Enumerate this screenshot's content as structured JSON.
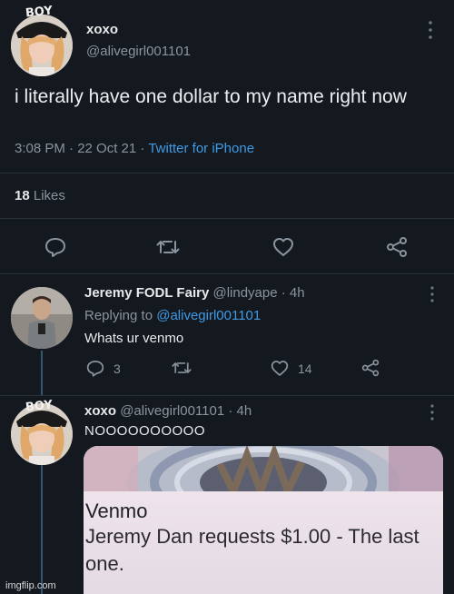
{
  "tweet": {
    "display_name": "xoxo",
    "handle": "@alivegirl001101",
    "text": "i literally have one dollar to my name right now",
    "time": "3:08 PM · 22 Oct 21 ·",
    "source": "Twitter for iPhone",
    "likes_count": "18",
    "likes_label": "Likes",
    "avatar_cap_text": "BOY"
  },
  "reply1": {
    "display_name": "Jeremy FODL Fairy",
    "handle": "@lindyape",
    "age": "· 4h",
    "replying_prefix": "Replying to",
    "replying_handle": "@alivegirl001101",
    "text": "Whats ur venmo",
    "reply_count": "3",
    "like_count": "14"
  },
  "reply2": {
    "display_name": "xoxo",
    "handle": "@alivegirl001101",
    "age": "· 4h",
    "text": "NOOOOOOOOOO",
    "avatar_cap_text": "BOY"
  },
  "venmo_notification": {
    "title": "Venmo",
    "body": "Jeremy Dan requests $1.00 - The last one."
  },
  "watermark": "imgflip.com",
  "icons": {
    "reply": "reply-icon",
    "retweet": "retweet-icon",
    "like": "heart-icon",
    "share": "share-icon",
    "more": "more-dots-icon"
  },
  "colors": {
    "background": "#14191f",
    "link": "#3f9ae6",
    "muted": "#8a949e",
    "thread_line": "#33576f"
  }
}
